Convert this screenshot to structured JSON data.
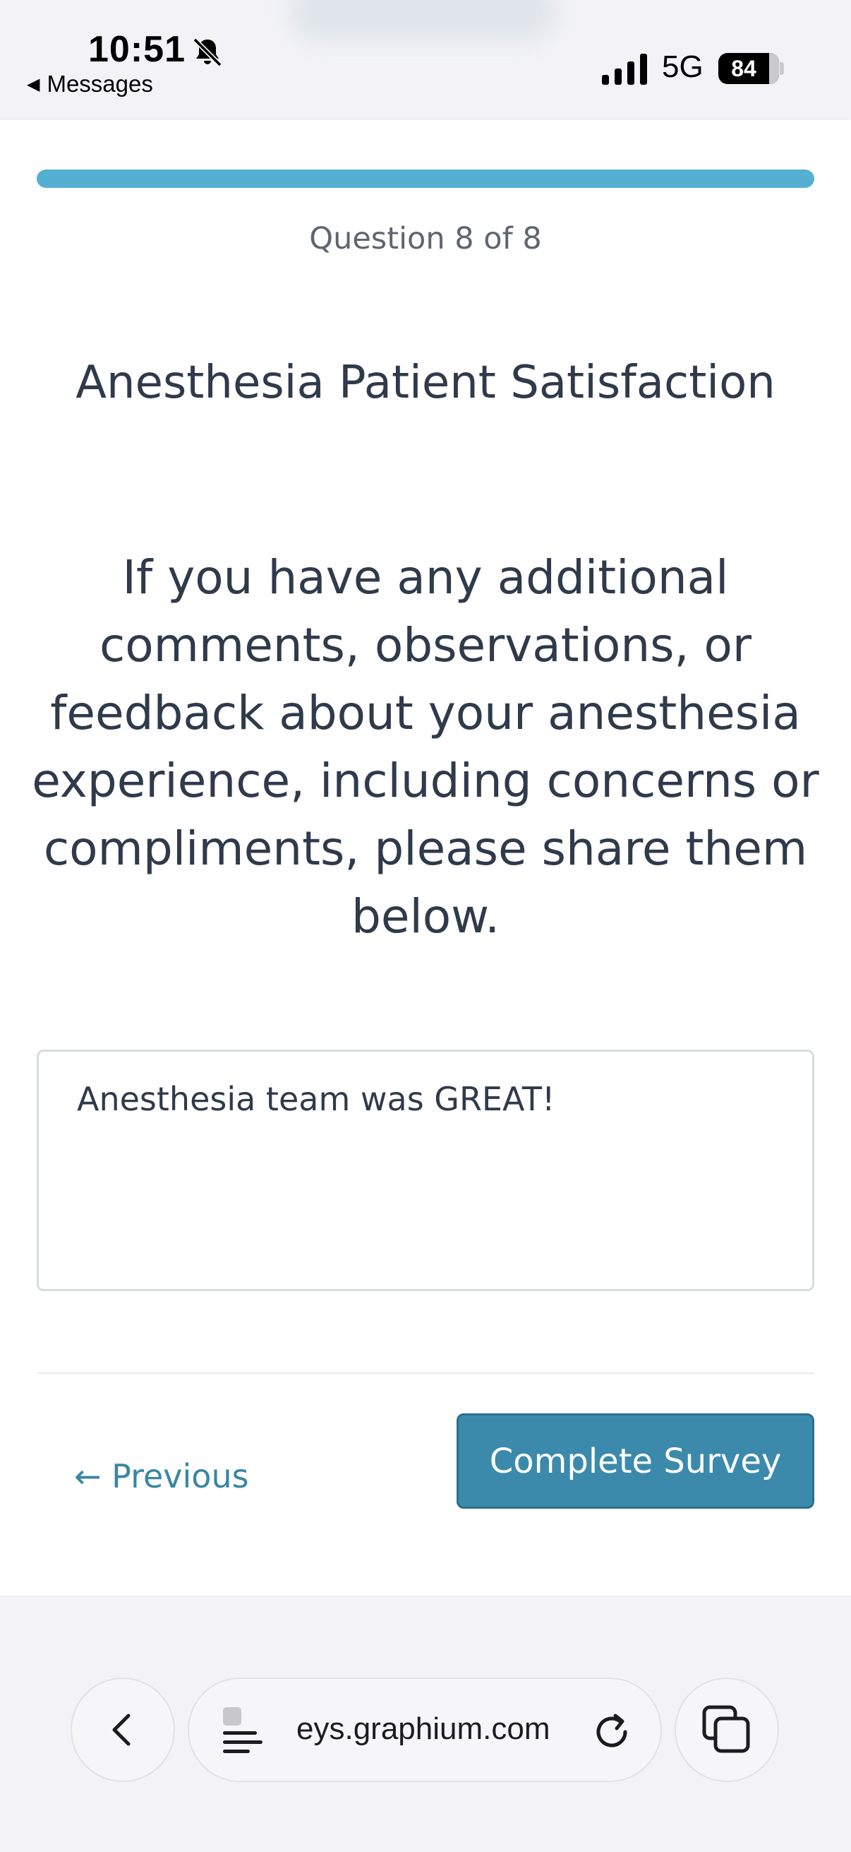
{
  "status_bar": {
    "time": "10:51",
    "back_label": "Messages",
    "network": "5G",
    "battery": "84"
  },
  "survey": {
    "progress_fraction": 1.0,
    "question_count": "Question 8 of 8",
    "title": "Anesthesia Patient Satisfaction",
    "question": "If you have any additional comments, observations, or feedback about your anesthesia experience, including concerns or compliments, please share them below.",
    "answer": "Anesthesia team was GREAT!",
    "previous_label": "← Previous",
    "complete_label": "Complete Survey"
  },
  "browser": {
    "url": "eys.graphium.com",
    "icons": [
      "back-chevron-icon",
      "page-menu-icon",
      "reload-icon",
      "tabs-icon"
    ]
  },
  "colors": {
    "progress": "#55afd3",
    "primary_button": "#3c8aab",
    "link": "#3a86a2",
    "text": "#2f3a4b"
  }
}
